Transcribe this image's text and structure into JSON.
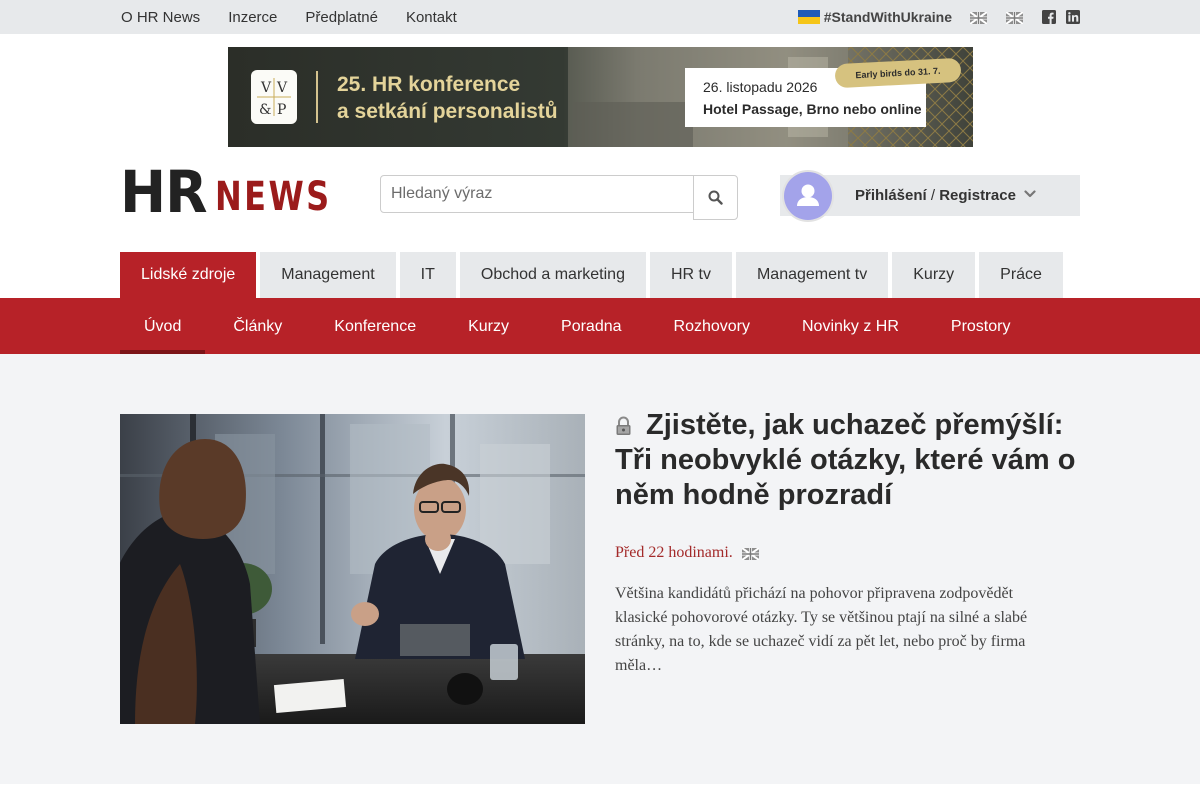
{
  "topbar": {
    "links": [
      "O HR News",
      "Inzerce",
      "Předplatné",
      "Kontakt"
    ],
    "ukraine_tag": "#StandWithUkraine",
    "language_icons": [
      "uk-flag-icon",
      "uk-flag-icon"
    ],
    "social_icons": [
      "facebook-icon",
      "linkedin-icon"
    ]
  },
  "banner": {
    "logo_text": "V V & P",
    "title_line1": "25. HR konference",
    "title_line2": "a setkání personalistů",
    "date": "26. listopadu 2026",
    "place": "Hotel Passage, Brno nebo online",
    "early_birds": "Early birds do 31. 7."
  },
  "header": {
    "logo_part1": "HR",
    "logo_part2": "NEWS",
    "search_placeholder": "Hledaný výraz",
    "login_label": "Přihlášení",
    "separator": "/",
    "register_label": "Registrace"
  },
  "main_nav": {
    "tabs": [
      {
        "label": "Lidské zdroje",
        "active": true
      },
      {
        "label": "Management",
        "active": false
      },
      {
        "label": "IT",
        "active": false
      },
      {
        "label": "Obchod a marketing",
        "active": false
      },
      {
        "label": "HR tv",
        "active": false
      },
      {
        "label": "Management tv",
        "active": false
      },
      {
        "label": "Kurzy",
        "active": false
      },
      {
        "label": "Práce",
        "active": false
      }
    ]
  },
  "sub_nav": {
    "items": [
      {
        "label": "Úvod",
        "active": true
      },
      {
        "label": "Články",
        "active": false
      },
      {
        "label": "Konference",
        "active": false
      },
      {
        "label": "Kurzy",
        "active": false
      },
      {
        "label": "Poradna",
        "active": false
      },
      {
        "label": "Rozhovory",
        "active": false
      },
      {
        "label": "Novinky z HR",
        "active": false
      },
      {
        "label": "Prostory",
        "active": false
      }
    ]
  },
  "article": {
    "title": "Zjistěte, jak uchazeč přemýšlí: Tři neobvyklé otázky, které vám o něm hodně prozradí",
    "time": "Před 22 hodinami.",
    "excerpt": "Většina kandidátů přichází na pohovor připravena zodpovědět klasické pohovorové otázky. Ty se většinou ptají na silné a slabé stránky, na to, kde se uchazeč vidí za pět let, nebo proč by firma měla…",
    "locked": true
  },
  "colors": {
    "brand_red": "#b72228",
    "topbar_gray": "#e7e9eb",
    "content_bg": "#f3f4f6",
    "banner_gold": "#e4d49a"
  }
}
